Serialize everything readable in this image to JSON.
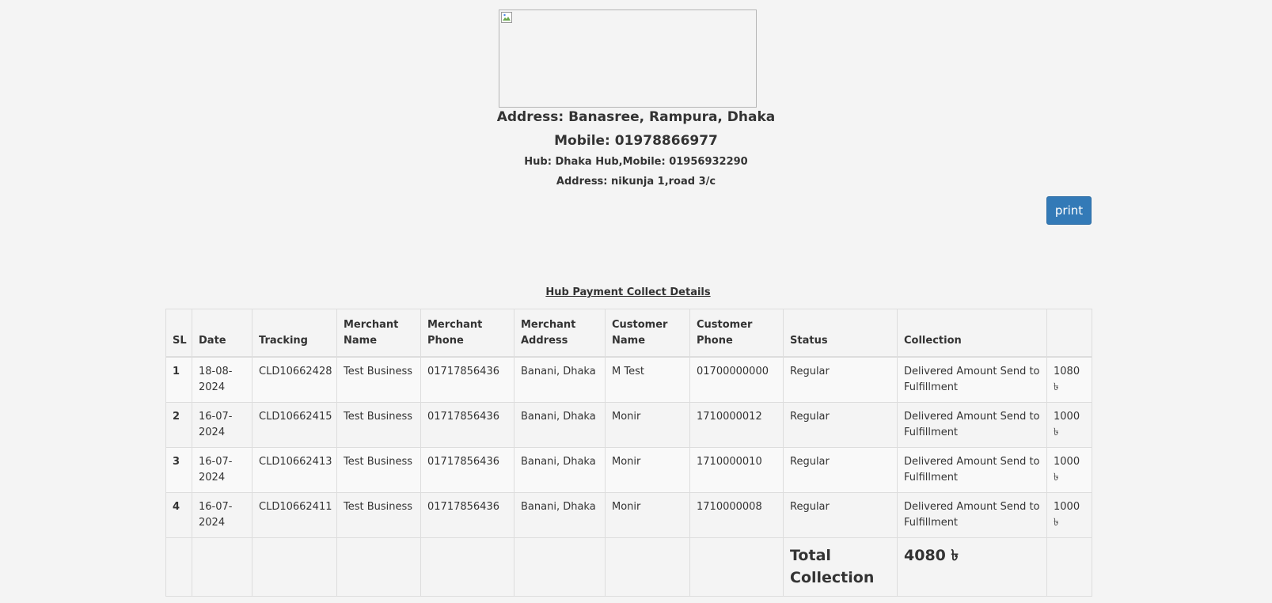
{
  "header": {
    "address": "Address: Banasree, Rampura, Dhaka",
    "mobile": "Mobile: 01978866977",
    "hub": "Hub: Dhaka Hub,Mobile: 01956932290",
    "hub_address": "Address: nikunja 1,road 3/c"
  },
  "actions": {
    "print_label": "print"
  },
  "table": {
    "title": "Hub Payment Collect Details",
    "columns": [
      "SL",
      "Date",
      "Tracking",
      "Merchant Name",
      "Merchant Phone",
      "Merchant Address",
      "Customer Name",
      "Customer Phone",
      "Status",
      "Collection",
      ""
    ],
    "rows": [
      [
        "1",
        "18-08-2024",
        "CLD10662428",
        "Test Business",
        "01717856436",
        "Banani, Dhaka",
        "M Test",
        "01700000000",
        "Regular",
        "Delivered Amount Send to Fulfillment",
        "1080 ৳"
      ],
      [
        "2",
        "16-07-2024",
        "CLD10662415",
        "Test Business",
        "01717856436",
        "Banani, Dhaka",
        "Monir",
        "1710000012",
        "Regular",
        "Delivered Amount Send to Fulfillment",
        "1000 ৳"
      ],
      [
        "3",
        "16-07-2024",
        "CLD10662413",
        "Test Business",
        "01717856436",
        "Banani, Dhaka",
        "Monir",
        "1710000010",
        "Regular",
        "Delivered Amount Send to Fulfillment",
        "1000 ৳"
      ],
      [
        "4",
        "16-07-2024",
        "CLD10662411",
        "Test Business",
        "01717856436",
        "Banani, Dhaka",
        "Monir",
        "1710000008",
        "Regular",
        "Delivered Amount Send to Fulfillment",
        "1000 ৳"
      ]
    ],
    "total_label": "Total Collection",
    "total_value": "4080 ৳"
  }
}
